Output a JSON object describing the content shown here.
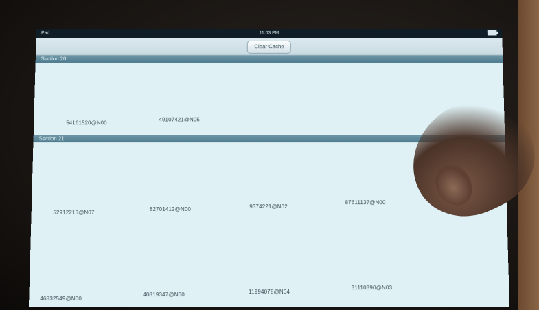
{
  "status_bar": {
    "carrier": "iPad",
    "time": "11:03 PM",
    "battery_icon": "battery-icon"
  },
  "nav_bar": {
    "clear_cache_label": "Clear Cache"
  },
  "sections": [
    {
      "header": "Section 20",
      "cells": [
        "54161520@N00",
        "49107421@N05"
      ]
    },
    {
      "header": "Section 21",
      "cells": [
        "52912216@N07",
        "82701412@N00",
        "9374221@N02",
        "87611137@N00",
        "46832549@N00",
        "40819347@N00",
        "11994078@N04",
        "31110390@N03"
      ]
    }
  ],
  "colors": {
    "screen_bg": "#dff1f5",
    "section_header": "#5a8798"
  }
}
